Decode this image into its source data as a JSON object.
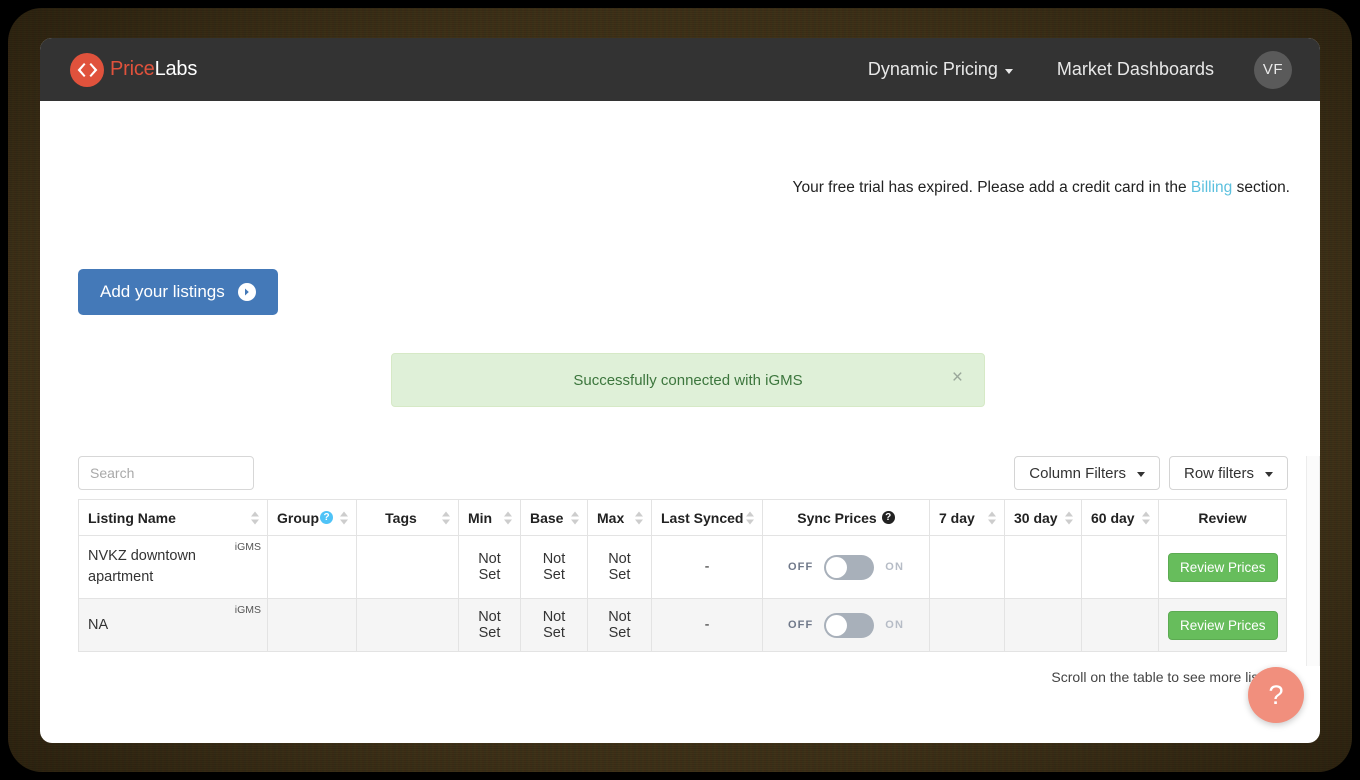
{
  "navbar": {
    "brand_price": "Price",
    "brand_labs": "Labs",
    "links": [
      {
        "label": "Dynamic Pricing",
        "has_caret": true
      },
      {
        "label": "Market Dashboards",
        "has_caret": false
      }
    ],
    "avatar_initials": "VF"
  },
  "notice": {
    "text_before": "Your free trial has expired. Please add a credit card in the ",
    "link": "Billing",
    "text_after": " section."
  },
  "add_listings": {
    "label": "Add your listings"
  },
  "alert": {
    "message": "Successfully connected with iGMS",
    "close_label": "×",
    "bg": "#dff0d8",
    "text_color": "#3c763d"
  },
  "controls": {
    "search_placeholder": "Search",
    "search_value": "",
    "column_filters": "Column Filters",
    "row_filters": "Row filters"
  },
  "table": {
    "columns": [
      {
        "label": "Listing Name",
        "sortable": true,
        "help": null,
        "align": "left"
      },
      {
        "label": "Group",
        "sortable": true,
        "help": "blue",
        "align": "left"
      },
      {
        "label": "Tags",
        "sortable": true,
        "help": null,
        "align": "center"
      },
      {
        "label": "Min",
        "sortable": true,
        "help": null,
        "align": "left"
      },
      {
        "label": "Base",
        "sortable": true,
        "help": null,
        "align": "left"
      },
      {
        "label": "Max",
        "sortable": true,
        "help": null,
        "align": "left"
      },
      {
        "label": "Last Synced",
        "sortable": true,
        "help": null,
        "align": "left"
      },
      {
        "label": "Sync Prices",
        "sortable": false,
        "help": "dark",
        "align": "center"
      },
      {
        "label": "7 day",
        "sortable": true,
        "help": null,
        "align": "left"
      },
      {
        "label": "30 day",
        "sortable": true,
        "help": null,
        "align": "left"
      },
      {
        "label": "60 day",
        "sortable": true,
        "help": null,
        "align": "left"
      },
      {
        "label": "Review",
        "sortable": false,
        "help": null,
        "align": "center"
      }
    ],
    "rows": [
      {
        "listing_name": "NVKZ downtown apartment",
        "source": "iGMS",
        "group": "",
        "tags": "",
        "min": "Not Set",
        "base": "Not Set",
        "max": "Not Set",
        "last_synced": "-",
        "sync_off": "OFF",
        "sync_on": "ON",
        "sync_state": "off",
        "day7": "",
        "day30": "",
        "day60": "",
        "review": "Review Prices"
      },
      {
        "listing_name": "NA",
        "source": "iGMS",
        "group": "",
        "tags": "",
        "min": "Not Set",
        "base": "Not Set",
        "max": "Not Set",
        "last_synced": "-",
        "sync_off": "OFF",
        "sync_on": "ON",
        "sync_state": "off",
        "day7": "",
        "day30": "",
        "day60": "",
        "review": "Review Prices"
      }
    ],
    "scroll_hint": "Scroll on the table to see more listings"
  },
  "help_fab": {
    "label": "?"
  }
}
